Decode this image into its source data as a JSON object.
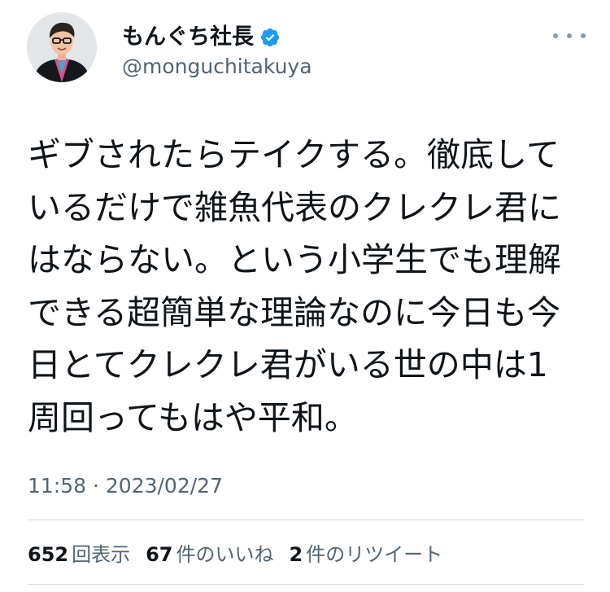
{
  "author": {
    "display_name": "もんぐち社長",
    "handle": "@monguchitakuya",
    "verified": true,
    "avatar": "profile-photo"
  },
  "tweet": {
    "text": "ギブされたらテイクする。徹底して\nいるだけで雑魚代表のクレクレ君に\nはならない。という小学生でも理解\nできる超簡単な理論なのに今日も今\n日とてクレクレ君がいる世の中は1\n周回ってもはや平和。",
    "timestamp": "11:58 · 2023/02/27"
  },
  "stats": {
    "views": {
      "count": "652",
      "label": "回表示"
    },
    "likes": {
      "count": "67",
      "label": "件のいいね"
    },
    "retweets": {
      "count": "2",
      "label": "件のリツイート"
    }
  },
  "icons": {
    "more": "more-horizontal-icon",
    "verified": "verified-badge-icon"
  },
  "colors": {
    "primary_text": "#0f1419",
    "secondary_text": "#536471",
    "verified_blue": "#1d9bf0",
    "divider": "#cfd9de"
  }
}
